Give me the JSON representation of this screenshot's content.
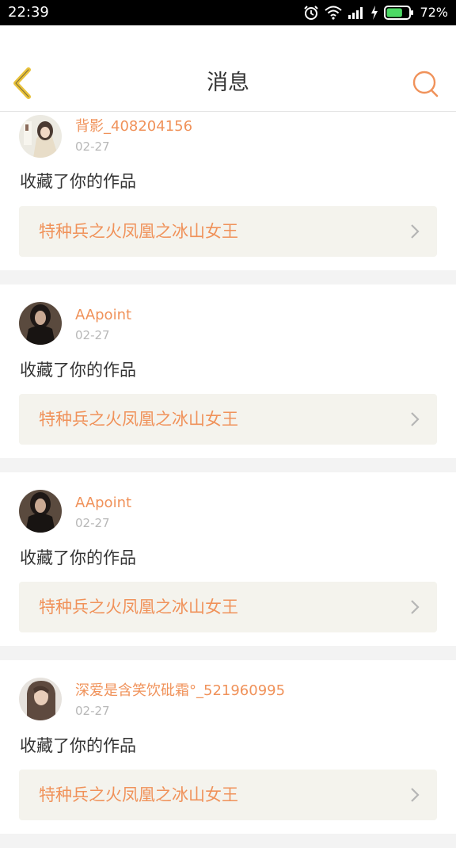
{
  "status_bar": {
    "time": "22:39",
    "battery": "72%",
    "battery_level": 0.72,
    "icons": [
      "alarm-icon",
      "wifi-icon",
      "signal-icon",
      "charging-icon",
      "battery-icon"
    ]
  },
  "header": {
    "title": "消息",
    "back_icon": "chevron-left-icon",
    "search_icon": "search-icon"
  },
  "colors": {
    "accent": "#f0925a",
    "back_icon": "#e9c23a",
    "card_link_bg": "#f4f3ed",
    "date_text": "#b8b8b8"
  },
  "messages": [
    {
      "username": "背影_408204156",
      "date": "02-27",
      "action": "收藏了你的作品",
      "work_title": "特种兵之火凤凰之冰山女王"
    },
    {
      "username": "AApoint",
      "date": "02-27",
      "action": "收藏了你的作品",
      "work_title": "特种兵之火凤凰之冰山女王"
    },
    {
      "username": "AApoint",
      "date": "02-27",
      "action": "收藏了你的作品",
      "work_title": "特种兵之火凤凰之冰山女王"
    },
    {
      "username": "深爱是含笑饮砒霜°_521960995",
      "date": "02-27",
      "action": "收藏了你的作品",
      "work_title": "特种兵之火凤凰之冰山女王"
    }
  ]
}
